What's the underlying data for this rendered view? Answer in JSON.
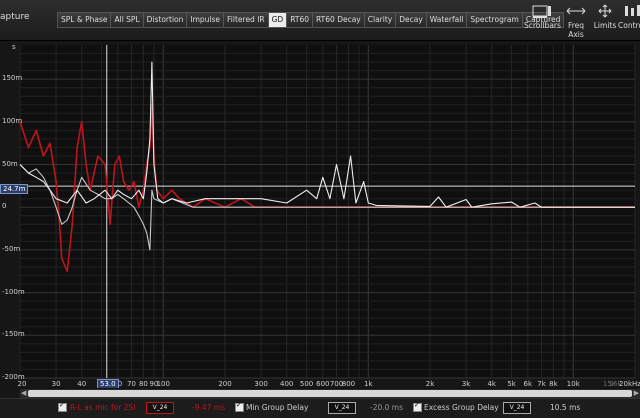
{
  "app": {
    "capture_label": "apture"
  },
  "tabs": [
    {
      "label": "SPL & Phase",
      "active": false
    },
    {
      "label": "All SPL",
      "active": false
    },
    {
      "label": "Distortion",
      "active": false
    },
    {
      "label": "Impulse",
      "active": false
    },
    {
      "label": "Filtered IR",
      "active": false
    },
    {
      "label": "GD",
      "active": true
    },
    {
      "label": "RT60",
      "active": false
    },
    {
      "label": "RT60 Decay",
      "active": false
    },
    {
      "label": "Clarity",
      "active": false
    },
    {
      "label": "Decay",
      "active": false
    },
    {
      "label": "Waterfall",
      "active": false
    },
    {
      "label": "Spectrogram",
      "active": false
    },
    {
      "label": "Captured",
      "active": false
    }
  ],
  "toolbar": {
    "scrollbars": "Scrollbars",
    "freq_axis": "Freq Axis",
    "limits": "Limits",
    "controls": "Controls"
  },
  "yaxis": {
    "unit_label": "s",
    "ticks": [
      "150m",
      "100m",
      "50m",
      "0",
      "-50m",
      "-100m",
      "-150m",
      "-200m"
    ]
  },
  "xaxis": {
    "ticks": [
      "20",
      "30",
      "40",
      "50",
      "60",
      "70",
      "80",
      "90",
      "100",
      "200",
      "300",
      "400",
      "500",
      "600",
      "700",
      "800",
      "1k",
      "2k",
      "3k",
      "4k",
      "5k",
      "6k",
      "7k",
      "8k",
      "10k",
      "15k",
      "16k",
      "20kHz"
    ],
    "dim_ticks": [
      "15k",
      "16k"
    ]
  },
  "markers": {
    "y_readout": "24.7m",
    "x_readout": "53.0"
  },
  "chart_data": {
    "type": "line",
    "xscale": "log",
    "xlim": [
      20,
      20000
    ],
    "ylim": [
      -0.2,
      0.19
    ],
    "ylabel": "s",
    "horizontal_marker": 0.0247,
    "vertical_marker": 53,
    "series": [
      {
        "name": "R-L as mic for 2SI",
        "color": "#c0141c",
        "points": [
          [
            20,
            0.1
          ],
          [
            22,
            0.07
          ],
          [
            24,
            0.09
          ],
          [
            26,
            0.06
          ],
          [
            28,
            0.075
          ],
          [
            30,
            0.03
          ],
          [
            31,
            -0.01
          ],
          [
            32,
            -0.06
          ],
          [
            34,
            -0.075
          ],
          [
            36,
            -0.02
          ],
          [
            38,
            0.07
          ],
          [
            40,
            0.1
          ],
          [
            42,
            0.05
          ],
          [
            44,
            0.02
          ],
          [
            48,
            0.06
          ],
          [
            52,
            0.05
          ],
          [
            55,
            -0.02
          ],
          [
            58,
            0.05
          ],
          [
            61,
            0.06
          ],
          [
            64,
            0.03
          ],
          [
            68,
            0.02
          ],
          [
            72,
            0.03
          ],
          [
            76,
            0.0
          ],
          [
            80,
            0.02
          ],
          [
            83,
            0.05
          ],
          [
            86,
            0.07
          ],
          [
            88,
            0.12
          ],
          [
            90,
            0.06
          ],
          [
            93,
            0.02
          ],
          [
            100,
            0.01
          ],
          [
            110,
            0.02
          ],
          [
            120,
            0.01
          ],
          [
            140,
            0.0
          ],
          [
            160,
            0.01
          ],
          [
            200,
            0.0
          ],
          [
            240,
            0.01
          ],
          [
            280,
            0.0
          ],
          [
            340,
            0.0
          ],
          [
            400,
            0.0
          ],
          [
            500,
            0.0
          ],
          [
            1000,
            0.0
          ],
          [
            20000,
            0.0
          ]
        ]
      },
      {
        "name": "Min Group Delay",
        "color": "#c8c8c8",
        "points": [
          [
            20,
            0.05
          ],
          [
            22,
            0.04
          ],
          [
            24,
            0.045
          ],
          [
            26,
            0.035
          ],
          [
            28,
            0.02
          ],
          [
            30,
            0.0
          ],
          [
            32,
            -0.02
          ],
          [
            34,
            -0.015
          ],
          [
            36,
            0.0
          ],
          [
            38,
            0.02
          ],
          [
            40,
            0.035
          ],
          [
            44,
            0.02
          ],
          [
            48,
            0.015
          ],
          [
            52,
            0.01
          ],
          [
            56,
            0.01
          ],
          [
            60,
            0.015
          ],
          [
            64,
            0.01
          ],
          [
            68,
            0.005
          ],
          [
            72,
            0.0
          ],
          [
            76,
            -0.01
          ],
          [
            80,
            -0.02
          ],
          [
            83,
            -0.03
          ],
          [
            86,
            -0.05
          ],
          [
            88,
            0.02
          ],
          [
            90,
            0.01
          ],
          [
            100,
            0.005
          ],
          [
            110,
            0.01
          ],
          [
            140,
            0.0
          ],
          [
            200,
            0.0
          ],
          [
            500,
            0.0
          ],
          [
            1000,
            0.0
          ],
          [
            20000,
            0.0
          ]
        ]
      },
      {
        "name": "Excess Group Delay",
        "color": "#eeeeee",
        "points": [
          [
            20,
            0.05
          ],
          [
            22,
            0.04
          ],
          [
            24,
            0.035
          ],
          [
            26,
            0.03
          ],
          [
            28,
            0.02
          ],
          [
            30,
            0.01
          ],
          [
            34,
            0.005
          ],
          [
            38,
            0.02
          ],
          [
            42,
            0.005
          ],
          [
            46,
            0.01
          ],
          [
            52,
            0.02
          ],
          [
            56,
            0.01
          ],
          [
            60,
            0.02
          ],
          [
            64,
            0.015
          ],
          [
            70,
            0.01
          ],
          [
            76,
            0.02
          ],
          [
            80,
            0.01
          ],
          [
            83,
            0.04
          ],
          [
            86,
            0.08
          ],
          [
            88,
            0.17
          ],
          [
            90,
            0.05
          ],
          [
            94,
            0.01
          ],
          [
            100,
            0.005
          ],
          [
            110,
            0.01
          ],
          [
            130,
            0.005
          ],
          [
            160,
            0.01
          ],
          [
            200,
            0.01
          ],
          [
            300,
            0.01
          ],
          [
            400,
            0.005
          ],
          [
            500,
            0.02
          ],
          [
            560,
            0.01
          ],
          [
            600,
            0.035
          ],
          [
            650,
            0.01
          ],
          [
            700,
            0.05
          ],
          [
            760,
            0.01
          ],
          [
            820,
            0.06
          ],
          [
            870,
            0.005
          ],
          [
            950,
            0.03
          ],
          [
            1000,
            0.005
          ],
          [
            1100,
            0.002
          ],
          [
            2000,
            0.001
          ],
          [
            2200,
            0.012
          ],
          [
            2400,
            0.0
          ],
          [
            3000,
            0.009
          ],
          [
            3200,
            0.0
          ],
          [
            4000,
            0.004
          ],
          [
            5000,
            0.006
          ],
          [
            5500,
            0.0
          ],
          [
            6500,
            0.005
          ],
          [
            7000,
            0.0
          ],
          [
            20000,
            0.0
          ]
        ]
      }
    ]
  },
  "legend": [
    {
      "checked": true,
      "label": "R-L as mic for 2SI",
      "swatch": "V_24",
      "value": "-9.47 ms",
      "color": "#c0141c"
    },
    {
      "checked": true,
      "label": "Min Group Delay",
      "swatch": "V_24",
      "value": "-20.0 ms",
      "color": "#c8c8c8"
    },
    {
      "checked": true,
      "label": "Excess Group Delay",
      "swatch": "V_24",
      "value": "10.5 ms",
      "color": "#eeeeee"
    }
  ],
  "icons": [
    "scrollbars-icon",
    "freq-axis-icon",
    "limits-icon",
    "controls-icon"
  ]
}
